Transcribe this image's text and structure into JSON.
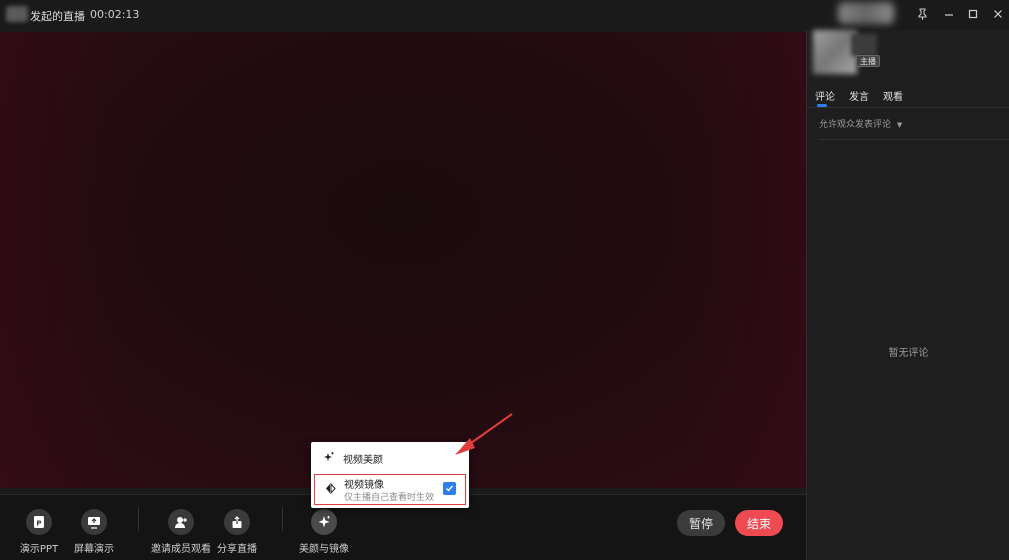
{
  "window": {
    "title": "发起的直播",
    "elapsed": "00:02:13"
  },
  "toolbar": {
    "items": [
      {
        "label": "演示PPT",
        "icon": "ppt-icon"
      },
      {
        "label": "屏幕演示",
        "icon": "screen-share-icon"
      },
      {
        "label": "邀请成员观看",
        "icon": "invite-member-icon"
      },
      {
        "label": "分享直播",
        "icon": "share-icon"
      },
      {
        "label": "美颜与镜像",
        "icon": "beauty-sparkle-icon"
      }
    ],
    "pause_label": "暂停",
    "end_label": "结束"
  },
  "popup": {
    "beauty_label": "视频美颜",
    "mirror_label": "视频镜像",
    "mirror_note": "仅主播自己查看时生效",
    "mirror_checked": true
  },
  "sidebar": {
    "host_badge": "主播",
    "tabs": [
      "评论",
      "发言",
      "观看"
    ],
    "active_tab": 0,
    "comment_filter": "允许观众发表评论",
    "empty_text": "暂无评论"
  },
  "colors": {
    "accent": "#2d7ff0",
    "end_button": "#ee4a52",
    "annotation": "#e23d3d"
  }
}
